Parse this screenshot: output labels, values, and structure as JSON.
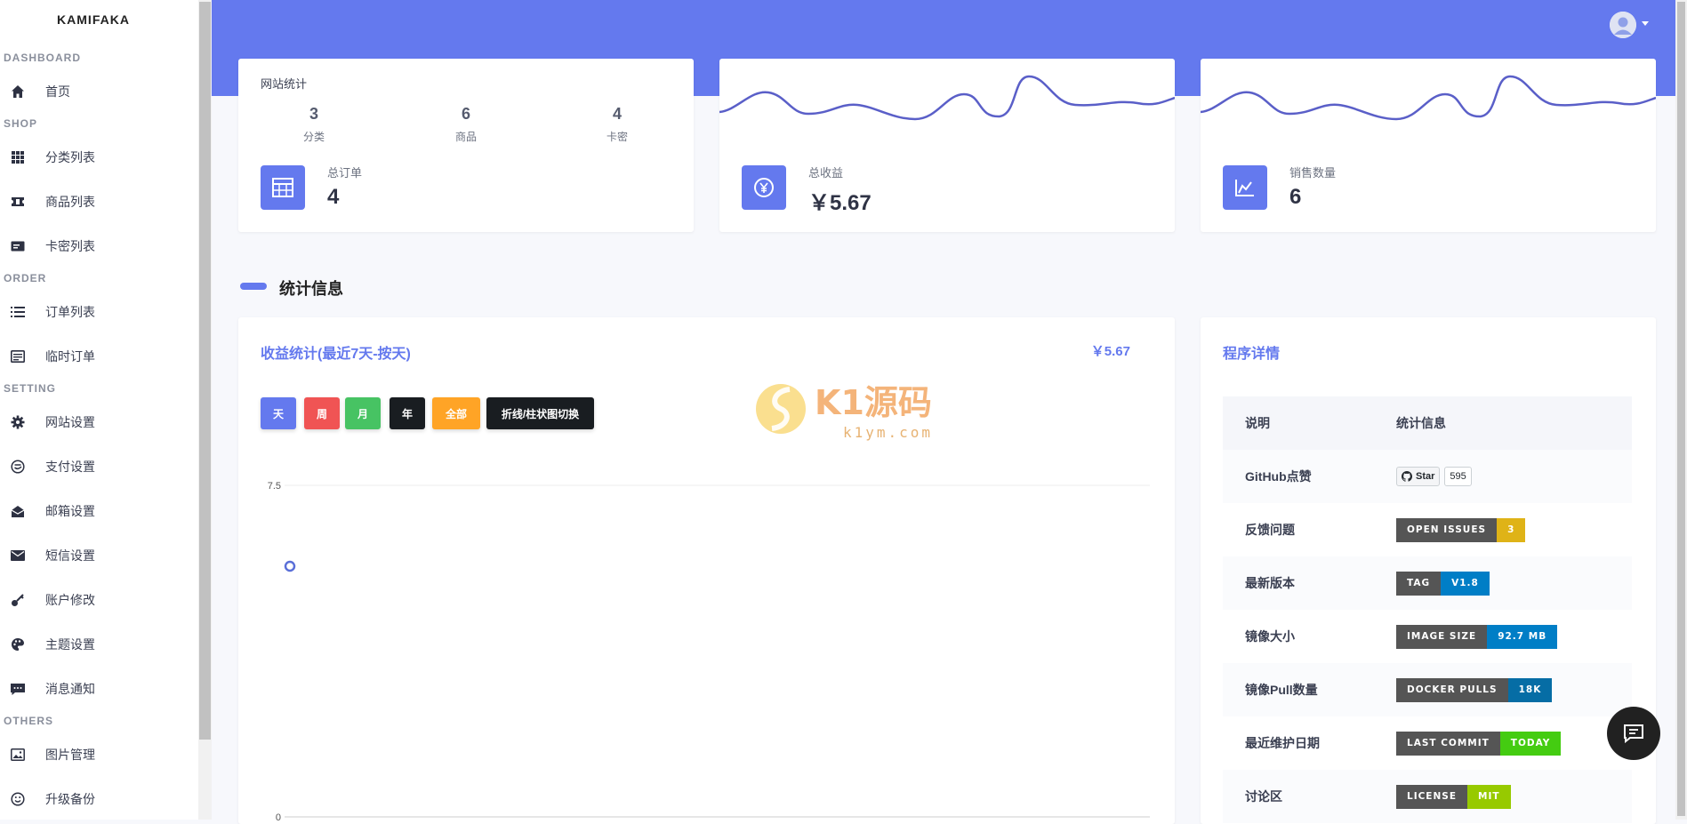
{
  "brand": "KAMIFAKA",
  "sidebar": {
    "sections": [
      {
        "title": "DASHBOARD"
      },
      {
        "title": "SHOP"
      },
      {
        "title": "ORDER"
      },
      {
        "title": "SETTING"
      },
      {
        "title": "OTHERS"
      }
    ],
    "items": [
      {
        "label": "首页",
        "icon": "home-icon"
      },
      {
        "label": "分类列表",
        "icon": "grid-icon"
      },
      {
        "label": "商品列表",
        "icon": "ticket-icon"
      },
      {
        "label": "卡密列表",
        "icon": "card-icon"
      },
      {
        "label": "订单列表",
        "icon": "list-icon"
      },
      {
        "label": "临时订单",
        "icon": "receipt-icon"
      },
      {
        "label": "网站设置",
        "icon": "gear-icon"
      },
      {
        "label": "支付设置",
        "icon": "payment-icon"
      },
      {
        "label": "邮箱设置",
        "icon": "mail-open-icon"
      },
      {
        "label": "短信设置",
        "icon": "envelope-icon"
      },
      {
        "label": "账户修改",
        "icon": "key-icon"
      },
      {
        "label": "主题设置",
        "icon": "palette-icon"
      },
      {
        "label": "消息通知",
        "icon": "message-icon"
      },
      {
        "label": "图片管理",
        "icon": "image-icon"
      },
      {
        "label": "升级备份",
        "icon": "smile-icon"
      }
    ]
  },
  "stats": {
    "site": {
      "title": "网站统计",
      "cols": [
        {
          "num": "3",
          "label": "分类"
        },
        {
          "num": "6",
          "label": "商品"
        },
        {
          "num": "4",
          "label": "卡密"
        }
      ],
      "big_label": "总订单",
      "big_value": "4"
    },
    "revenue": {
      "label": "总收益",
      "value": "￥5.67"
    },
    "sales": {
      "label": "销售数量",
      "value": "6"
    }
  },
  "section_title": "统计信息",
  "chart_card": {
    "title": "收益统计(最近7天-按天)",
    "total": "￥5.67",
    "buttons": [
      {
        "label": "天",
        "color": "#6479ee"
      },
      {
        "label": "周",
        "color": "#f05454"
      },
      {
        "label": "月",
        "color": "#47c363"
      },
      {
        "label": "年",
        "color": "#191d21"
      },
      {
        "label": "全部",
        "color": "#ffa426"
      },
      {
        "label": "折线/柱状图切换",
        "color": "#191d21"
      }
    ]
  },
  "chart_data": {
    "type": "line",
    "ylim": [
      0,
      7.5
    ],
    "yticks": [
      "7.5",
      "0"
    ],
    "series": [
      {
        "values": [
          5.67
        ]
      }
    ]
  },
  "program": {
    "title": "程序详情",
    "headers": [
      "说明",
      "统计信息"
    ],
    "rows": [
      {
        "label": "GitHub点赞",
        "star": "Star",
        "count": "595"
      },
      {
        "label": "反馈问题",
        "badge_left": "OPEN ISSUES",
        "badge_right": "3",
        "color": "#dfb317"
      },
      {
        "label": "最新版本",
        "badge_left": "TAG",
        "badge_right": "V1.8",
        "color": "#007ec6"
      },
      {
        "label": "镜像大小",
        "badge_left": "IMAGE SIZE",
        "badge_right": "92.7 MB",
        "color": "#007ec6"
      },
      {
        "label": "镜像Pull数量",
        "badge_left": "DOCKER PULLS",
        "badge_right": "18K",
        "color": "#066da5"
      },
      {
        "label": "最近维护日期",
        "badge_left": "LAST COMMIT",
        "badge_right": "TODAY",
        "color": "#4c1"
      },
      {
        "label": "讨论区",
        "badge_left": "LICENSE",
        "badge_right": "MIT",
        "color": "#97ca00"
      }
    ]
  },
  "watermark": {
    "main": "K1源码",
    "sub": "k1ym.com"
  }
}
